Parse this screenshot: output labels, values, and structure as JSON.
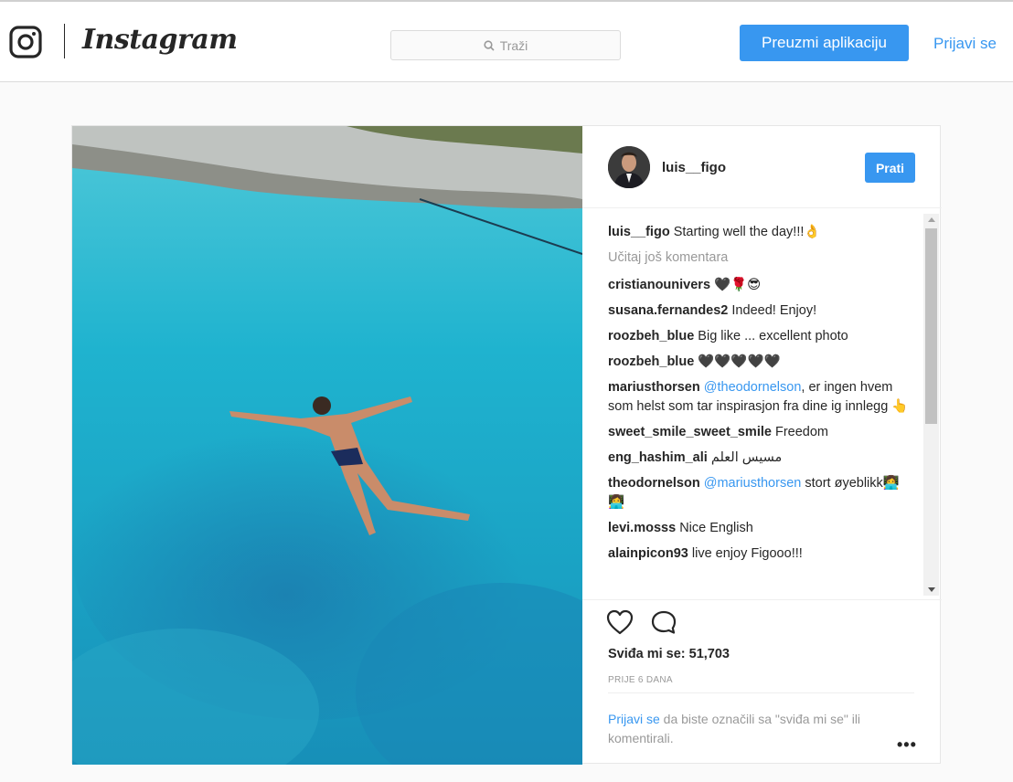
{
  "nav": {
    "brand": "Instagram",
    "search_placeholder": "Traži",
    "get_app_label": "Preuzmi aplikaciju",
    "login_label": "Prijavi se"
  },
  "post": {
    "username": "luis__figo",
    "follow_label": "Prati",
    "caption_user": "luis__figo",
    "caption_text": "Starting well the day!!!👌",
    "load_more": "Učitaj još komentara",
    "comments": [
      {
        "user": "cristianounivers",
        "text": "🖤🌹😎"
      },
      {
        "user": "susana.fernandes2",
        "text": "Indeed! Enjoy!"
      },
      {
        "user": "roozbeh_blue",
        "text": "Big like ... excellent photo"
      },
      {
        "user": "roozbeh_blue",
        "text": "🖤🖤🖤🖤🖤"
      },
      {
        "user": "mariusthorsen",
        "mention": "@theodornelson",
        "text": ", er ingen hvem som helst som tar inspirasjon fra dine ig innlegg 👆"
      },
      {
        "user": "sweet_smile_sweet_smile",
        "text": "Freedom"
      },
      {
        "user": "eng_hashim_ali",
        "text": "مسيس العلم"
      },
      {
        "user": "theodornelson",
        "mention": "@mariusthorsen",
        "text": " stort øyeblikk👩‍💻👩‍💻"
      },
      {
        "user": "levi.mosss",
        "text": "Nice English"
      },
      {
        "user": "alainpicon93",
        "text": "live enjoy Figooo!!!"
      }
    ],
    "likes_text": "Sviđa mi se: 51,703",
    "time_ago": "PRIJE 6 DANA",
    "login_link": "Prijavi se",
    "login_prompt_rest": " da biste označili sa \"sviđa mi se\" ili komentirali.",
    "more_options": "•••"
  },
  "colors": {
    "accent": "#3897f0",
    "muted": "#999999",
    "border": "#dbdbdb"
  }
}
